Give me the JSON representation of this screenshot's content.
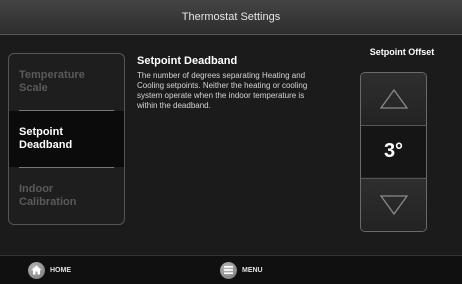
{
  "header": {
    "title": "Thermostat Settings"
  },
  "sidebar": {
    "items": [
      {
        "label": "Temperature Scale",
        "state": "inactive"
      },
      {
        "label": "Setpoint Deadband",
        "state": "selected"
      },
      {
        "label": "Indoor Calibration",
        "state": "inactive"
      }
    ]
  },
  "description": {
    "title": "Setpoint Deadband",
    "body": "The number of degrees separating Heating and Cooling setpoints. Neither the heating or cooling system operate when the indoor temperature is within the deadband."
  },
  "offset": {
    "label": "Setpoint Offset",
    "value": "3°",
    "up_icon": "triangle-up-icon",
    "down_icon": "triangle-down-icon"
  },
  "footer": {
    "home_label": "HOME",
    "home_icon": "home-icon",
    "menu_label": "MENU",
    "menu_icon": "menu-icon"
  },
  "colors": {
    "background": "#151515",
    "title_bar": "#3a3a3a",
    "inactive_text": "#5a5a5a",
    "selected_background": "#0b0b0b"
  }
}
